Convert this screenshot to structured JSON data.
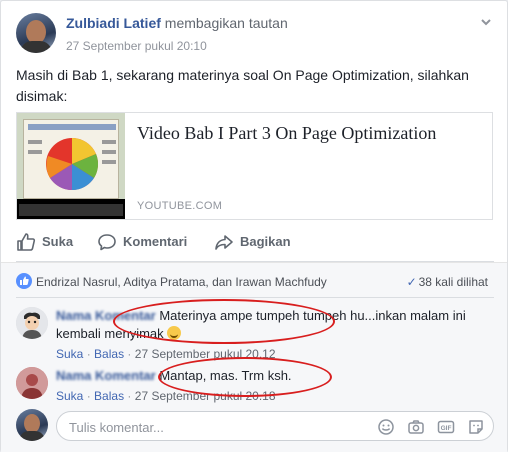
{
  "post": {
    "author_name": "Zulbiadi Latief",
    "author_action": "membagikan tautan",
    "timestamp": "27 September pukul 20:10",
    "text": "Masih di Bab 1, sekarang materinya soal On Page Optimization, silahkan disimak:",
    "options_icon": "chevron-down-icon"
  },
  "link_preview": {
    "title": "Video Bab I Part 3 On Page Optimization",
    "source": "YOUTUBE.COM"
  },
  "actions": {
    "like": "Suka",
    "comment": "Komentari",
    "share": "Bagikan"
  },
  "engagement": {
    "reactors": "Endrizal Nasrul, Aditya Pratama, dan Irawan Machfudy",
    "seen": "38 kali dilihat"
  },
  "comments": [
    {
      "text_before": "Materinya ampe tumpeh tumpeh hu...",
      "text_after": "inkan malam ini kembali menyimak",
      "like": "Suka",
      "reply": "Balas",
      "time": "27 September pukul 20.12"
    },
    {
      "text": "Mantap, mas. Trm ksh.",
      "like": "Suka",
      "reply": "Balas",
      "time": "27 September pukul 20.18"
    }
  ],
  "composer": {
    "placeholder": "Tulis komentar..."
  },
  "colors": {
    "link_blue": "#365899",
    "annotation_red": "#d81e1e",
    "like_blue": "#5890ff"
  }
}
